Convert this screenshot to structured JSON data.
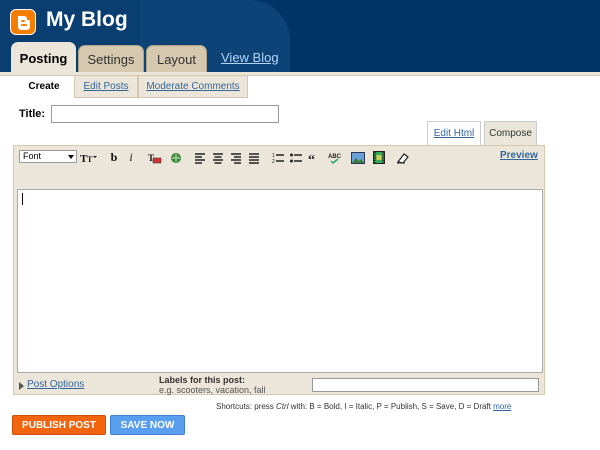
{
  "header": {
    "blog_title": "My Blog",
    "logo": "blogger-logo-icon",
    "tabs": [
      "Posting",
      "Settings",
      "Layout"
    ],
    "view_blog": "View Blog"
  },
  "subtabs": [
    "Create",
    "Edit Posts",
    "Moderate Comments"
  ],
  "title_label": "Title:",
  "title_value": "",
  "mode_tabs": {
    "edit_html": "Edit Html",
    "compose": "Compose"
  },
  "toolbar": {
    "font": "Font",
    "bold": "b",
    "italic": "i",
    "preview": "Preview",
    "icons": [
      "font-size-icon",
      "text-color-icon",
      "link-icon",
      "align-left-icon",
      "align-center-icon",
      "align-right-icon",
      "justify-icon",
      "numbered-list-icon",
      "bullet-list-icon",
      "blockquote-icon",
      "spellcheck-icon",
      "image-icon",
      "video-icon",
      "remove-formatting-icon"
    ]
  },
  "editor_body": "",
  "footer": {
    "post_options": "Post Options",
    "labels_title": "Labels for this post:",
    "labels_hint": "e.g. scooters, vacation, fall",
    "labels_value": ""
  },
  "shortcuts": {
    "prefix": "Shortcuts: press ",
    "key": "Ctrl",
    "text": " with: B = Bold, I = Italic, P = Publish, S = Save, D = Draft ",
    "more": "more"
  },
  "buttons": {
    "publish": "PUBLISH POST",
    "save": "SAVE NOW"
  },
  "colors": {
    "header": "#003366",
    "publish": "#f2650e",
    "save": "#5a9ef0",
    "tab": "#d5c8ae"
  }
}
